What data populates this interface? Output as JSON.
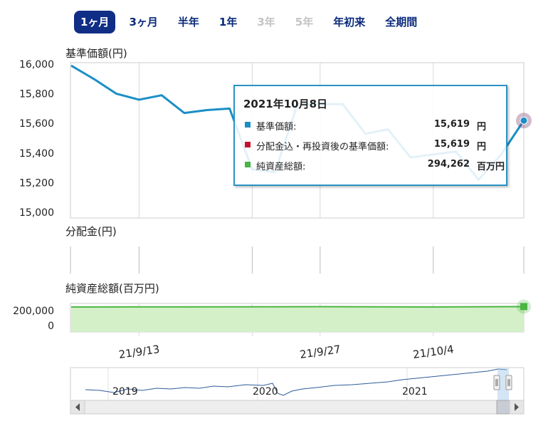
{
  "tabs": [
    {
      "label": "1ヶ月",
      "state": "active"
    },
    {
      "label": "3ヶ月",
      "state": "normal"
    },
    {
      "label": "半年",
      "state": "normal"
    },
    {
      "label": "1年",
      "state": "normal"
    },
    {
      "label": "3年",
      "state": "disabled"
    },
    {
      "label": "5年",
      "state": "disabled"
    },
    {
      "label": "年初来",
      "state": "normal"
    },
    {
      "label": "全期間",
      "state": "normal"
    }
  ],
  "panels": {
    "nav_title": "基準価額(円)",
    "dist_title": "分配金(円)",
    "assets_title": "純資産総額(百万円)"
  },
  "tooltip": {
    "date": "2021年10月8日",
    "rows": [
      {
        "label": "基準価額:",
        "value": "15,619",
        "unit": "円",
        "color": "#1a8fc6"
      },
      {
        "label": "分配金込・再投資後の基準価額:",
        "value": "15,619",
        "unit": "円",
        "color": "#c8102e"
      },
      {
        "label": "純資産総額:",
        "value": "294,262",
        "unit": "百万円",
        "color": "#4bb543"
      }
    ]
  },
  "colors": {
    "nav": "#1a8fc6",
    "assets": "#4bb543",
    "assets_fill": "#d4f0c8",
    "grid": "#d8d8d8",
    "navigator": "#2f5c9a"
  },
  "chart_data": [
    {
      "type": "line",
      "title": "基準価額(円)",
      "x": [
        "2021-09-08",
        "2021-09-09",
        "2021-09-10",
        "2021-09-13",
        "2021-09-14",
        "2021-09-15",
        "2021-09-16",
        "2021-09-17",
        "2021-09-21",
        "2021-09-22",
        "2021-09-24",
        "2021-09-27",
        "2021-09-28",
        "2021-09-29",
        "2021-09-30",
        "2021-10-01",
        "2021-10-04",
        "2021-10-05",
        "2021-10-06",
        "2021-10-07",
        "2021-10-08"
      ],
      "series": [
        {
          "values": [
            15990,
            15900,
            15800,
            15760,
            15790,
            15670,
            15690,
            15700,
            15290,
            15270,
            15730,
            15730,
            15730,
            15530,
            15560,
            15370,
            15390,
            15410,
            15220,
            15390,
            15619
          ]
        }
      ],
      "ylim": [
        15000,
        16000
      ],
      "yticks": [
        "16,000",
        "15,800",
        "15,600",
        "15,400",
        "15,200",
        "15,000"
      ]
    },
    {
      "type": "bar",
      "title": "分配金(円)",
      "values": []
    },
    {
      "type": "area",
      "title": "純資産総額(百万円)",
      "x": [
        "2021-09-08",
        "2021-09-13",
        "2021-09-27",
        "2021-10-04",
        "2021-10-08"
      ],
      "series": [
        {
          "values": [
            290000,
            290500,
            293000,
            290000,
            294262
          ]
        }
      ],
      "ylim": [
        0,
        330000
      ],
      "yticks": [
        "200,000",
        "0"
      ]
    }
  ],
  "x_tick_labels": [
    "21/9/13",
    "21/9/27",
    "21/10/4"
  ],
  "navigator": {
    "year_labels": [
      "2019",
      "2020",
      "2021"
    ]
  }
}
